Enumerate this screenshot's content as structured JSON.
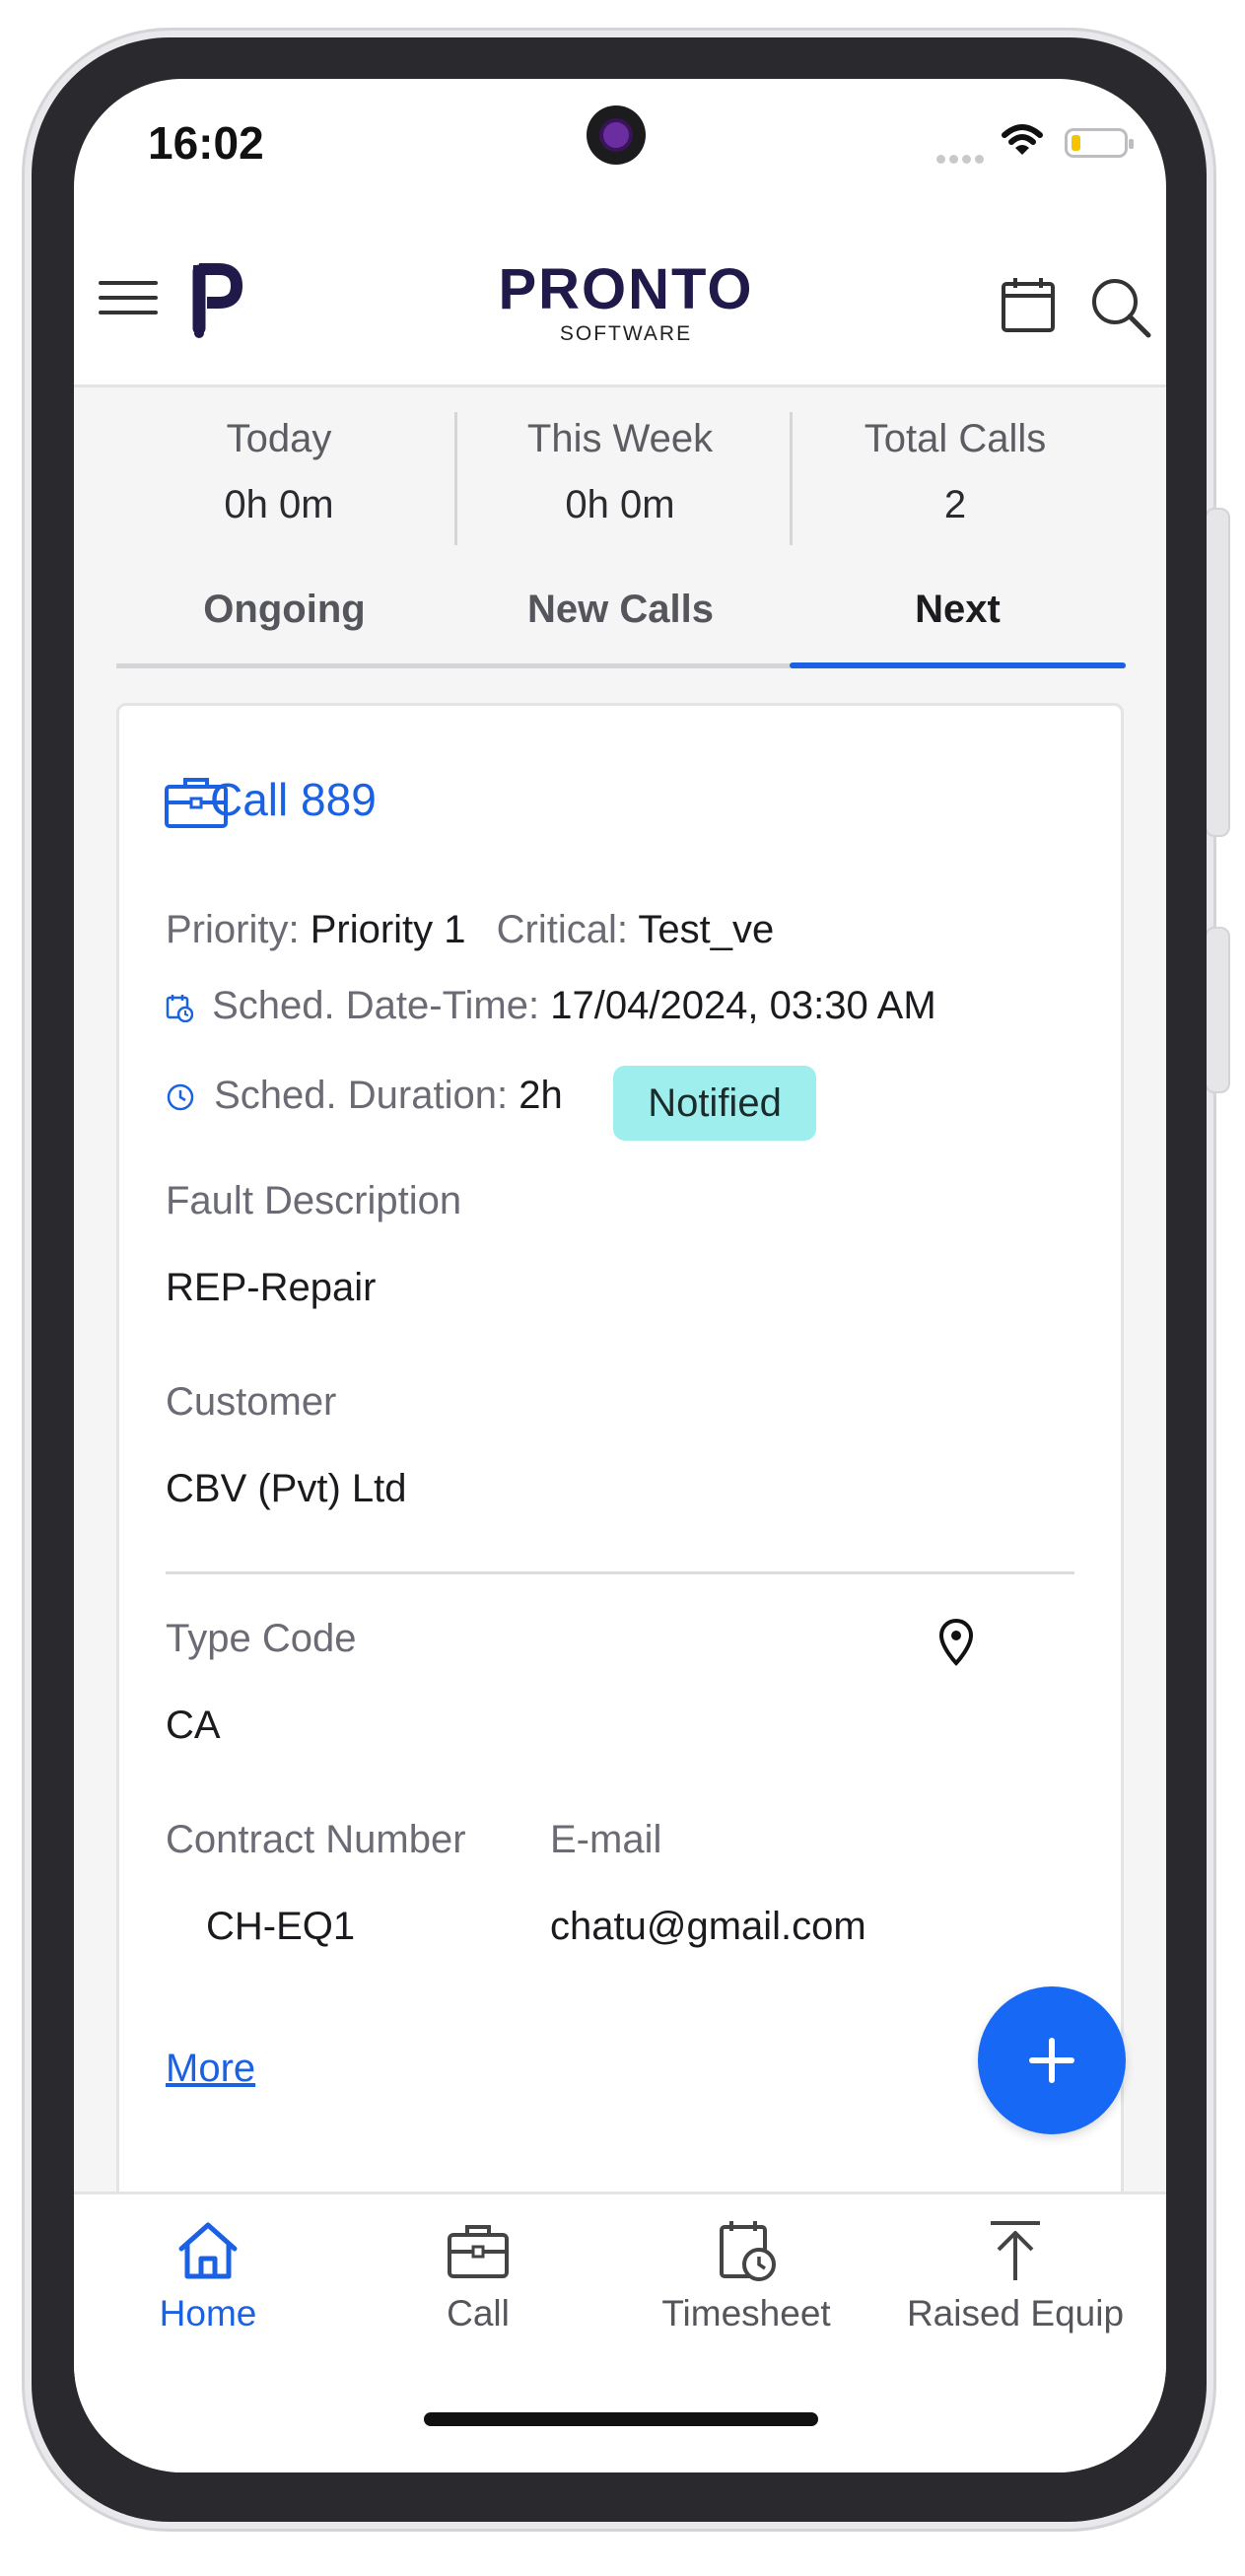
{
  "status_bar": {
    "time": "16:02"
  },
  "header": {
    "brand_name": "PRONTO",
    "brand_sub": "SOFTWARE",
    "icons": {
      "menu": "hamburger-icon",
      "logo": "pronto-p-logo",
      "calendar": "calendar-icon",
      "search": "search-icon"
    }
  },
  "summary": {
    "stats": [
      {
        "label": "Today",
        "value": "0h 0m"
      },
      {
        "label": "This Week",
        "value": "0h 0m"
      },
      {
        "label": "Total Calls",
        "value": "2"
      }
    ]
  },
  "tabs": [
    {
      "label": "Ongoing",
      "active": false
    },
    {
      "label": "New Calls",
      "active": false
    },
    {
      "label": "Next",
      "active": true
    }
  ],
  "call_card": {
    "title": "Call 889",
    "priority_label": "Priority:",
    "priority_value": "Priority 1",
    "critical_label": "Critical:",
    "critical_value": "Test_ve",
    "sched_datetime_label": "Sched. Date-Time:",
    "sched_datetime_value": "17/04/2024, 03:30 AM",
    "sched_duration_label": "Sched. Duration:",
    "sched_duration_value": "2h",
    "status_badge": "Notified",
    "fault_description_label": "Fault Description",
    "fault_description_value": "REP-Repair",
    "customer_label": "Customer",
    "customer_value": "CBV (Pvt) Ltd",
    "type_code_label": "Type Code",
    "type_code_value": "CA",
    "contract_number_label": "Contract Number",
    "contract_number_value": "CH-EQ1",
    "email_label": "E-mail",
    "email_value": "chatu@gmail.com",
    "more_link": "More"
  },
  "colors": {
    "accent": "#1a62e3",
    "fab": "#1668f5",
    "badge_bg": "#9eeeee"
  },
  "bottom_nav": [
    {
      "label": "Home",
      "icon": "home-icon",
      "active": true
    },
    {
      "label": "Call",
      "icon": "briefcase-icon",
      "active": false
    },
    {
      "label": "Timesheet",
      "icon": "timesheet-icon",
      "active": false
    },
    {
      "label": "Raised Equip",
      "icon": "upload-arrow-icon",
      "active": false
    }
  ]
}
